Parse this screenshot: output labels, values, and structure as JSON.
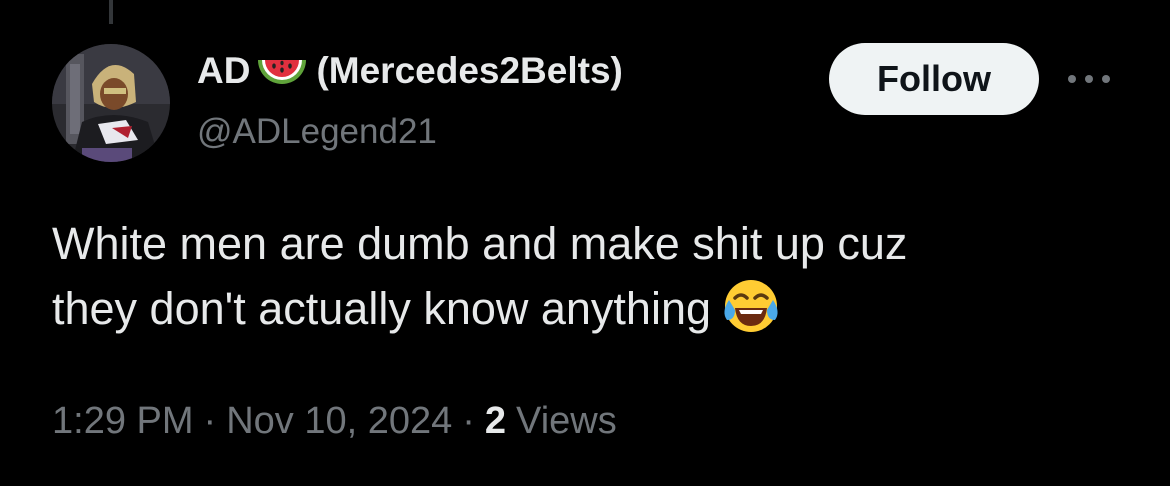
{
  "tweet": {
    "author": {
      "display_name_prefix": "AD",
      "display_name_emoji": "watermelon",
      "display_name_suffix": "(Mercedes2Belts)",
      "handle": "@ADLegend21"
    },
    "follow_label": "Follow",
    "more_icon": "more-horizontal-icon",
    "text_line_1": "White men are dumb and make shit up cuz",
    "text_line_2": "they don't actually know anything",
    "text_emoji": "face-with-tears-of-joy",
    "time": "1:29 PM",
    "date": "Nov 10, 2024",
    "separator": "·",
    "views_count": "2",
    "views_label": "Views"
  },
  "colors": {
    "background": "#000000",
    "primary_text": "#e7e9ea",
    "secondary_text": "#71767b",
    "follow_bg": "#eff3f4",
    "follow_text": "#0f1419",
    "thread_line": "#333639"
  }
}
